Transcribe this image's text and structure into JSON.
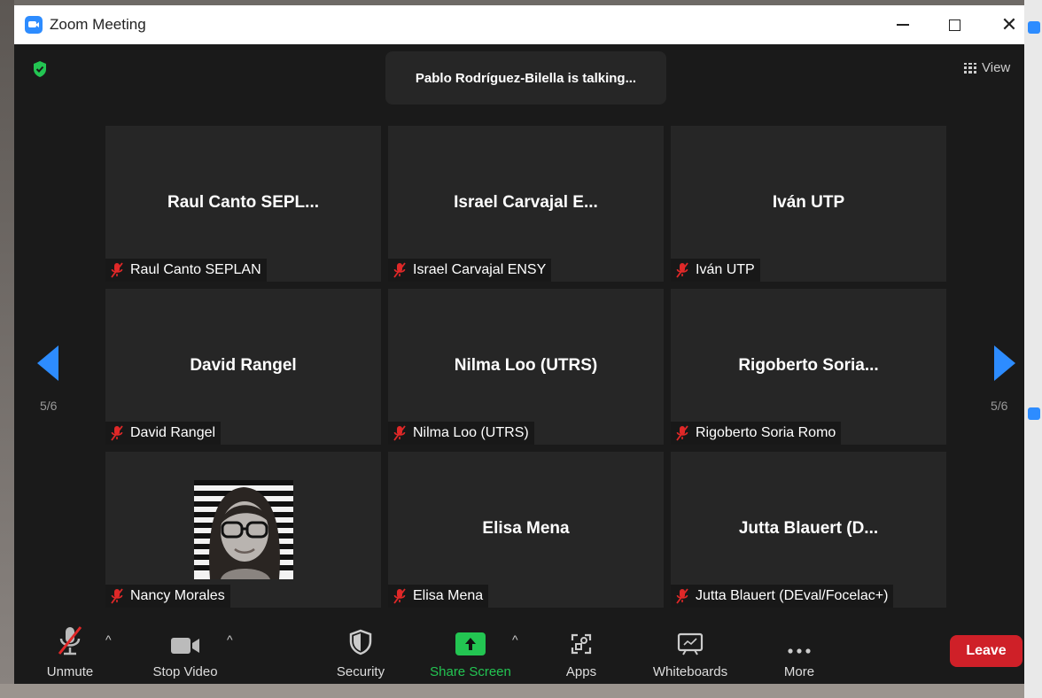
{
  "window": {
    "title": "Zoom Meeting"
  },
  "meeting": {
    "talking_text": "Pablo Rodríguez-Bilella is talking...",
    "view_label": "View",
    "page_left": "5/6",
    "page_right": "5/6"
  },
  "tiles": [
    {
      "name": "Raul Canto SEPL...",
      "label": "Raul Canto SEPLAN"
    },
    {
      "name": "Israel Carvajal E...",
      "label": "Israel Carvajal ENSY"
    },
    {
      "name": "Iván UTP",
      "label": "Iván UTP"
    },
    {
      "name": "David Rangel",
      "label": "David Rangel"
    },
    {
      "name": "Nilma Loo (UTRS)",
      "label": "Nilma Loo (UTRS)"
    },
    {
      "name": "Rigoberto Soria...",
      "label": "Rigoberto Soria Romo"
    },
    {
      "name": "",
      "label": "Nancy Morales"
    },
    {
      "name": "Elisa Mena",
      "label": "Elisa Mena"
    },
    {
      "name": "Jutta Blauert (D...",
      "label": "Jutta Blauert (DEval/Focelac+)"
    }
  ],
  "toolbar": {
    "unmute": "Unmute",
    "stop_video": "Stop Video",
    "security": "Security",
    "share_screen": "Share Screen",
    "apps": "Apps",
    "whiteboards": "Whiteboards",
    "more": "More",
    "leave": "Leave"
  },
  "colors": {
    "accent": "#2d8cff",
    "share_green": "#23c552",
    "leave_red": "#cf2028",
    "muted_red": "#e02828",
    "tile_bg": "#262626"
  }
}
